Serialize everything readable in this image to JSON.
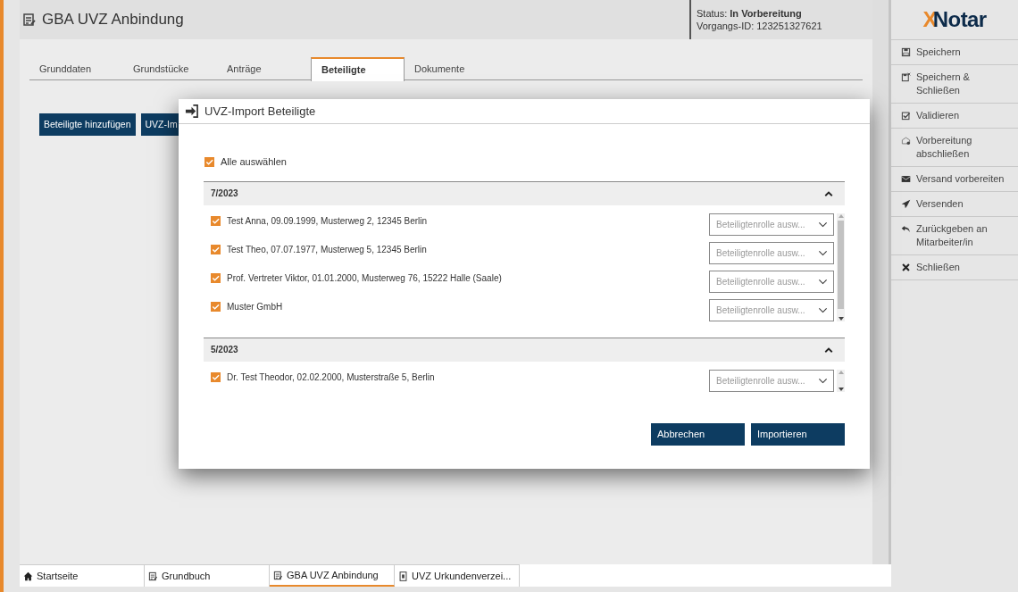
{
  "header": {
    "title": "GBA UVZ Anbindung",
    "status_label": "Status:",
    "status_value": "In Vorbereitung",
    "case_id": "Vorgangs-ID: 123251327621"
  },
  "tabs": [
    {
      "label": "Grunddaten",
      "selected": false
    },
    {
      "label": "Grundstücke",
      "selected": false
    },
    {
      "label": "Anträge",
      "selected": false
    },
    {
      "label": "Beteiligte",
      "selected": true
    },
    {
      "label": "Dokumente",
      "selected": false
    }
  ],
  "actions": [
    "Beteiligte hinzufügen",
    "UVZ-Im"
  ],
  "dialog": {
    "title": "UVZ-Import Beteiligte",
    "select_all": {
      "label": "Alle auswählen",
      "checked": true
    },
    "groups": [
      {
        "title": "7/2023",
        "expanded": true,
        "items": [
          {
            "label": "Test Anna, 09.09.1999, Musterweg 2, 12345 Berlin",
            "checked": true,
            "placeholder": "Beteiligtenrolle ausw..."
          },
          {
            "label": "Test Theo, 07.07.1977, Musterweg 5, 12345 Berlin",
            "checked": true,
            "placeholder": "Beteiligtenrolle ausw..."
          },
          {
            "label": "Prof. Vertreter Viktor, 01.01.2000, Musterweg 76, 15222 Halle (Saale)",
            "checked": true,
            "placeholder": "Beteiligtenrolle ausw..."
          },
          {
            "label": "Muster GmbH",
            "checked": true,
            "placeholder": "Beteiligtenrolle ausw..."
          }
        ]
      },
      {
        "title": "5/2023",
        "expanded": true,
        "items": [
          {
            "label": "Dr. Test Theodor, 02.02.2000, Musterstraße 5, Berlin",
            "checked": true,
            "placeholder": "Beteiligtenrolle ausw..."
          }
        ]
      }
    ],
    "buttons": [
      "Abbrechen",
      "Importieren"
    ]
  },
  "logo": "XNotar",
  "sidebar": {
    "items": [
      {
        "label": "Speichern",
        "kind": "save"
      },
      {
        "label": "Speichern & Schließen",
        "kind": "save-close"
      },
      {
        "label": "Validieren",
        "kind": "validate"
      },
      {
        "label": "Vorbereitung abschließen",
        "kind": "finish"
      },
      {
        "label": "Versand vorbereiten",
        "kind": "mail"
      },
      {
        "label": "Versenden",
        "kind": "send"
      },
      {
        "label": "Zurückgeben an Mitarbeiter/in",
        "kind": "return"
      },
      {
        "label": "Schließen",
        "kind": "close"
      }
    ]
  },
  "taskbar": [
    {
      "label": "Startseite",
      "kind": "home",
      "selected": false
    },
    {
      "label": "Grundbuch",
      "kind": "doc",
      "selected": false
    },
    {
      "label": "GBA UVZ Anbindung",
      "kind": "doc",
      "selected": true
    },
    {
      "label": "UVZ Urkundenverzei...",
      "kind": "register",
      "selected": false
    }
  ]
}
